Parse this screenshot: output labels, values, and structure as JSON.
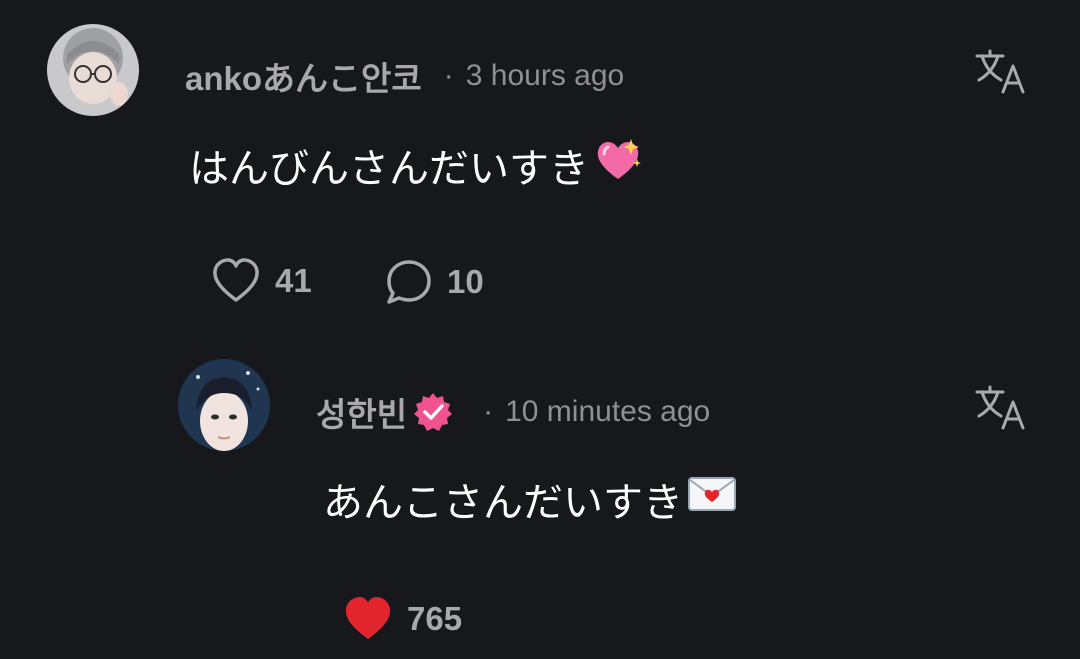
{
  "comments": [
    {
      "username": "ankoあんこ안코",
      "separator": "·",
      "time": "3 hours ago",
      "text": "はんびんさんだいすき",
      "emoji": "sparkling-heart",
      "likes": "41",
      "replies": "10",
      "liked": false
    },
    {
      "username": "성한빈",
      "verified": true,
      "separator": "·",
      "time": "10 minutes ago",
      "text": "あんこさんだいすき",
      "emoji": "love-letter",
      "likes": "765",
      "liked": true
    }
  ],
  "colors": {
    "background": "#17181c",
    "username": "#a9a9ad",
    "timestamp": "#8f8f94",
    "like_active": "#e3262d",
    "verified_badge": "#f0538f"
  }
}
